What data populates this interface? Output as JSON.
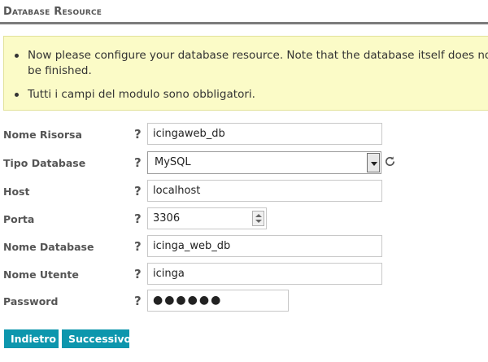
{
  "section_title": "Database Resource",
  "notice": {
    "line1a": "Now please configure your database resource. Note that the database itself does not need to",
    "line1b": "be finished.",
    "line2": "Tutti i campi del modulo sono obbligatori."
  },
  "form": {
    "help_glyph": "?",
    "fields": [
      {
        "label": "Nome Risorsa",
        "value": "icingaweb_db"
      },
      {
        "label": "Tipo Database",
        "value": "MySQL"
      },
      {
        "label": "Host",
        "value": "localhost"
      },
      {
        "label": "Porta",
        "value": "3306"
      },
      {
        "label": "Nome Database",
        "value": "icinga_web_db"
      },
      {
        "label": "Nome Utente",
        "value": "icinga"
      },
      {
        "label": "Password",
        "value": "●●●●●●"
      }
    ]
  },
  "buttons": {
    "back": "Indietro",
    "next": "Successivo"
  }
}
